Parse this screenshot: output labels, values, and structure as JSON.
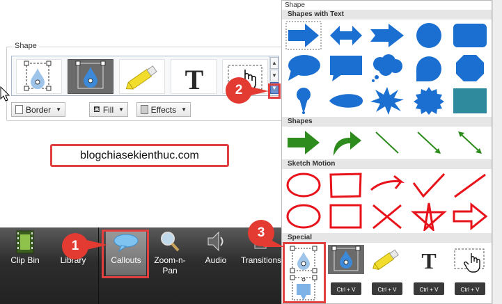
{
  "shape_panel": {
    "title": "Shape",
    "border_label": "Border",
    "fill_label": "Fill",
    "effects_label": "Effects"
  },
  "url_box": {
    "text": "blogchiasekienthuc.com"
  },
  "taskbar": {
    "items": [
      {
        "label": "Clip Bin",
        "icon": "film-icon"
      },
      {
        "label": "Library",
        "icon": "library-icon"
      },
      {
        "label": "Callouts",
        "icon": "speech-bubble-icon",
        "selected": true
      },
      {
        "label": "Zoom-n-\nPan",
        "icon": "magnifier-icon"
      },
      {
        "label": "Audio",
        "icon": "speaker-icon"
      },
      {
        "label": "Transitions",
        "icon": "transitions-icon"
      }
    ]
  },
  "dropdown": {
    "title": "Shape",
    "sections": {
      "shapes_with_text": "Shapes with Text",
      "shapes": "Shapes",
      "sketch_motion": "Sketch Motion",
      "special": "Special"
    },
    "special_keys_label": "Ctrl + V"
  },
  "badges": {
    "one": "1",
    "two": "2",
    "three": "3"
  },
  "colors": {
    "shape_blue": "#1a6fd1",
    "arrow_green": "#2e8b1e",
    "sketch_red": "#e8121b",
    "highlight_red": "#e04040",
    "badge_red": "#e33a32",
    "teal_rect": "#2f8a9e"
  }
}
